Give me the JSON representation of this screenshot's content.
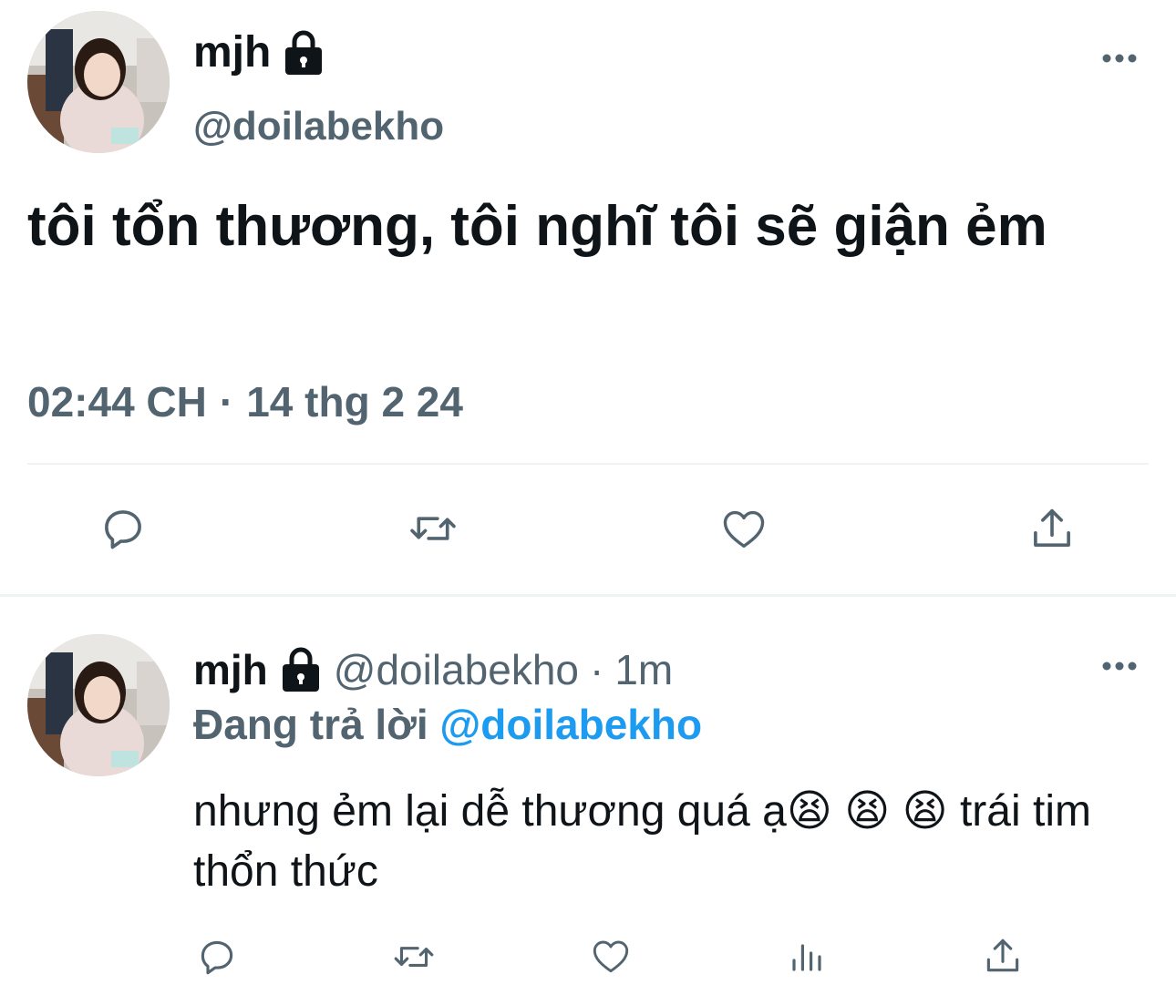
{
  "main_tweet": {
    "display_name": "mjh",
    "handle": "@doilabekho",
    "text": "tôi tổn thương, tôi nghĩ tôi sẽ giận ẻm",
    "time": "02:44 CH",
    "separator": "·",
    "date": "14 thg 2 24",
    "more_icon": "more-horizontal-icon",
    "actions": [
      "reply-icon",
      "retweet-icon",
      "like-icon",
      "share-icon"
    ]
  },
  "reply_tweet": {
    "display_name": "mjh",
    "handle": "@doilabekho",
    "separator": "·",
    "age": "1m",
    "replying_prefix": "Đang trả lời",
    "replying_to": "@doilabekho",
    "text": "nhưng ẻm lại dễ thương quá ạ😫 😫 😫  trái tim thổn thức",
    "more_icon": "more-horizontal-icon",
    "actions": [
      "reply-icon",
      "retweet-icon",
      "like-icon",
      "analytics-icon",
      "share-icon"
    ]
  },
  "colors": {
    "text_primary": "#0f1419",
    "text_secondary": "#536471",
    "accent": "#1d9bf0",
    "divider": "#eff3f4"
  }
}
